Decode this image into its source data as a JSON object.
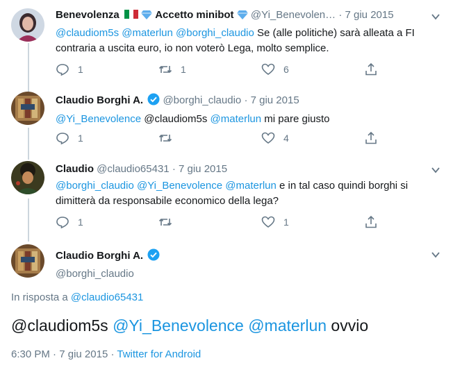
{
  "tweets": [
    {
      "name": "Benevolenza",
      "name_suffix": "Accetto minibot",
      "handle": "@Yi_Benevolen…",
      "date": "7 giu 2015",
      "text_parts": [
        "@claudiom5s",
        " ",
        "@materlun",
        " ",
        "@borghi_claudio",
        " Se (alle politiche) sarà alleata a FI contraria a uscita euro, io non voterò Lega, molto semplice."
      ],
      "replies": "1",
      "retweets": "1",
      "likes": "6"
    },
    {
      "name": "Claudio Borghi A.",
      "handle": "@borghi_claudio",
      "date": "7 giu 2015",
      "text_parts": [
        "@Yi_Benevolence",
        " @claudiom5s ",
        "@materlun",
        " mi pare giusto"
      ],
      "replies": "1",
      "retweets": "",
      "likes": "4"
    },
    {
      "name": "Claudio",
      "handle": "@claudio65431",
      "date": "7 giu 2015",
      "text_parts": [
        "@borghi_claudio",
        " ",
        "@Yi_Benevolence",
        " ",
        "@materlun",
        " e in tal caso quindi borghi si dimitterà da responsabile economico della lega?"
      ],
      "replies": "1",
      "retweets": "",
      "likes": "1"
    }
  ],
  "main_tweet": {
    "name": "Claudio Borghi A.",
    "handle": "@borghi_claudio",
    "reply_prefix": "In risposta a ",
    "reply_to": "@claudio65431",
    "text_parts": [
      "@claudiom5s",
      " ",
      "@Yi_Benevolence",
      " ",
      "@materlun",
      " ovvio"
    ],
    "time": "6:30 PM",
    "date": "7 giu 2015",
    "source": "Twitter for Android"
  },
  "separator": "·",
  "colors": {
    "link": "#1b95e0",
    "muted": "#657786",
    "verified": "#1da1f2"
  }
}
